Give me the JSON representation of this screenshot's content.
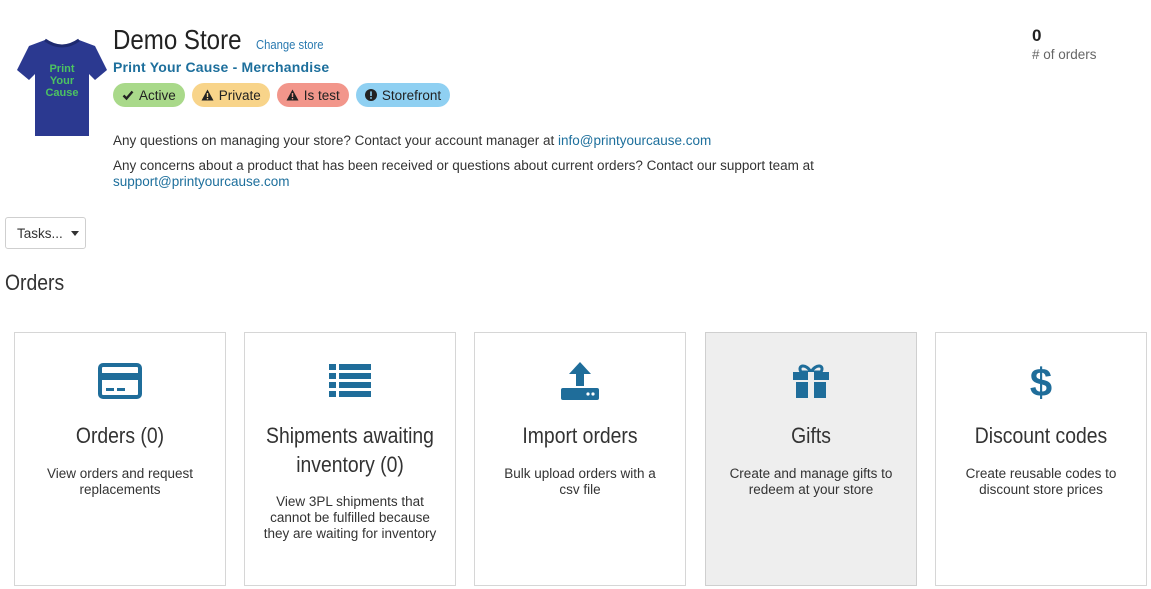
{
  "store": {
    "name": "Demo Store",
    "change_link": "Change store",
    "subtitle": "Print Your Cause - Merchandise",
    "logo_text": [
      "Print",
      "Your",
      "Cause"
    ],
    "badges": [
      {
        "label": "Active",
        "icon": "check-icon",
        "color": "#a9d98a"
      },
      {
        "label": "Private",
        "icon": "warning-icon",
        "color": "#f8d48a"
      },
      {
        "label": "Is test",
        "icon": "warning-icon",
        "color": "#f2968b"
      },
      {
        "label": "Storefront",
        "icon": "exclamation-circle-icon",
        "color": "#8fd0f2"
      }
    ]
  },
  "info": {
    "line1_text": "Any questions on managing your store? Contact your account manager at ",
    "line1_email": "info@printyourcause.com",
    "line2_text": "Any concerns about a product that has been received or questions about current orders? Contact our support team at",
    "line2_email": "support@printyourcause.com"
  },
  "stats": {
    "orders_count": "0",
    "orders_label": "# of orders"
  },
  "toolbar": {
    "tasks_label": "Tasks..."
  },
  "section": {
    "title": "Orders"
  },
  "cards": [
    {
      "title": "Orders (0)",
      "desc": "View orders and request replacements",
      "icon": "credit-card-icon"
    },
    {
      "title": "Shipments awaiting inventory (0)",
      "desc": "View 3PL shipments that cannot be fulfilled because they are waiting for inventory",
      "icon": "list-icon"
    },
    {
      "title": "Import orders",
      "desc": "Bulk upload orders with a csv file",
      "icon": "upload-icon"
    },
    {
      "title": "Gifts",
      "desc": "Create and manage gifts to redeem at your store",
      "icon": "gift-icon"
    },
    {
      "title": "Discount codes",
      "desc": "Create reusable codes to discount store prices",
      "icon": "dollar-icon"
    }
  ],
  "colors": {
    "accent": "#1d6f9c",
    "icon": "#1f6d9a",
    "shirt": "#2b3990",
    "shirt_text": "#4cc261"
  }
}
